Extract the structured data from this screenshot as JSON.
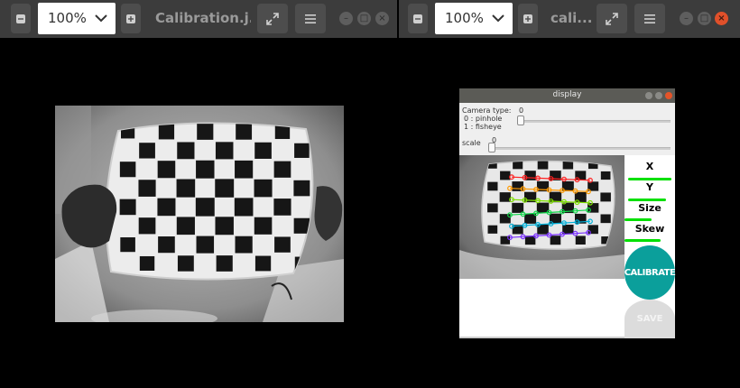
{
  "left_window": {
    "zoom": "100%",
    "title": "Calibration.j...",
    "icons": [
      "minus-icon",
      "chevron-down-icon",
      "plus-icon",
      "fullscreen-icon",
      "menu-icon"
    ]
  },
  "right_window": {
    "zoom": "100%",
    "title": "cali...",
    "icons": [
      "minus-icon",
      "chevron-down-icon",
      "plus-icon",
      "fullscreen-icon",
      "menu-icon"
    ]
  },
  "display": {
    "title": "display",
    "camera_type_label": "Camera type:",
    "camera_option_pinhole": "0 : pinhole",
    "camera_option_fisheye": "1 : fisheye",
    "camera_type_value": "0",
    "scale_label": "scale",
    "scale_value": "0",
    "sidebar": {
      "x_label": "X",
      "y_label": "Y",
      "size_label": "Size",
      "skew_label": "Skew",
      "calibrate_label": "CALIBRATE",
      "save_label": "SAVE"
    }
  },
  "colors": {
    "titlebar": "#3c3c3c",
    "close": "#e0502a",
    "calibrate": "#0b9f9b",
    "progress": "#00e000"
  }
}
